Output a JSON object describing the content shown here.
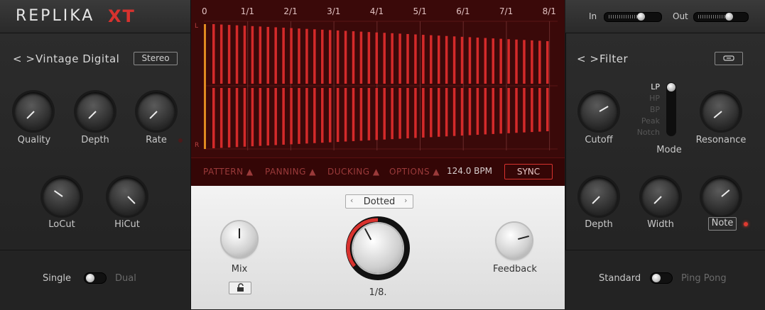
{
  "header": {
    "logo": "REPLIKA",
    "logo_suffix": "XT"
  },
  "io": {
    "in_label": "In",
    "out_label": "Out"
  },
  "left": {
    "preset_nav": "< >",
    "preset_name": "Vintage Digital",
    "stereo_button": "Stereo",
    "knobs_row1": [
      "Quality",
      "Depth",
      "Rate"
    ],
    "knobs_row2": [
      "LoCut",
      "HiCut"
    ],
    "mode_left": "Single",
    "mode_right": "Dual"
  },
  "display": {
    "timeline": [
      "0",
      "1/1",
      "2/1",
      "3/1",
      "4/1",
      "5/1",
      "6/1",
      "7/1",
      "8/1"
    ],
    "channel_top": "L",
    "channel_bottom": "R",
    "tabs": [
      "PATTERN ▲",
      "PANNING ▲",
      "DUCKING ▲",
      "OPTIONS ▲"
    ],
    "bpm": "124.0 BPM",
    "sync": "SYNC"
  },
  "center": {
    "timing_mode": "Dotted",
    "mix_label": "Mix",
    "feedback_label": "Feedback",
    "time_value": "1/8."
  },
  "right": {
    "nav": "< >",
    "title": "Filter",
    "modes": [
      "LP",
      "HP",
      "BP",
      "Peak",
      "Notch"
    ],
    "selected_mode": "LP",
    "mode_label": "Mode",
    "knobs_row1": [
      "Cutoff",
      "Resonance"
    ],
    "knobs_row2": [
      "Depth",
      "Width",
      "Note"
    ],
    "mode_left": "Standard",
    "mode_right": "Ping Pong"
  },
  "colors": {
    "accent": "#d8322e",
    "display_bg": "#3a0909",
    "bar": "#d42a2a"
  }
}
